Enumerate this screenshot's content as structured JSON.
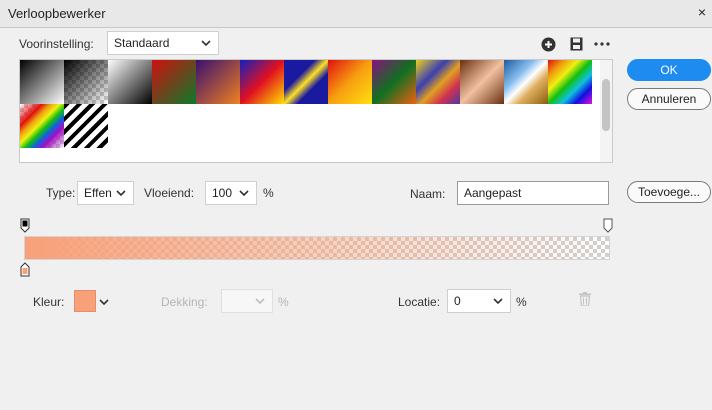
{
  "window": {
    "title": "Verloopbewerker",
    "close_glyph": "×"
  },
  "preset": {
    "label": "Voorinstelling:",
    "value": "Standaard"
  },
  "actions": {
    "ok": "OK",
    "cancel": "Annuleren",
    "new": "Toevoege..."
  },
  "type": {
    "label": "Type:",
    "value": "Effen"
  },
  "smoothness": {
    "label": "Vloeiend:",
    "value": "100",
    "unit": "%"
  },
  "name": {
    "label": "Naam:",
    "value": "Aangepast"
  },
  "stop_controls": {
    "color_label": "Kleur:",
    "opacity_label": "Dekking:",
    "opacity_unit": "%",
    "location_label": "Locatie:",
    "location_value": "0",
    "location_unit": "%"
  },
  "colors": {
    "accent": "#1e8bf0",
    "stop_color": "#f8a078"
  },
  "icons": [
    "chevron-down-icon",
    "plus-circle-icon",
    "save-icon",
    "more-icon",
    "trash-icon"
  ]
}
